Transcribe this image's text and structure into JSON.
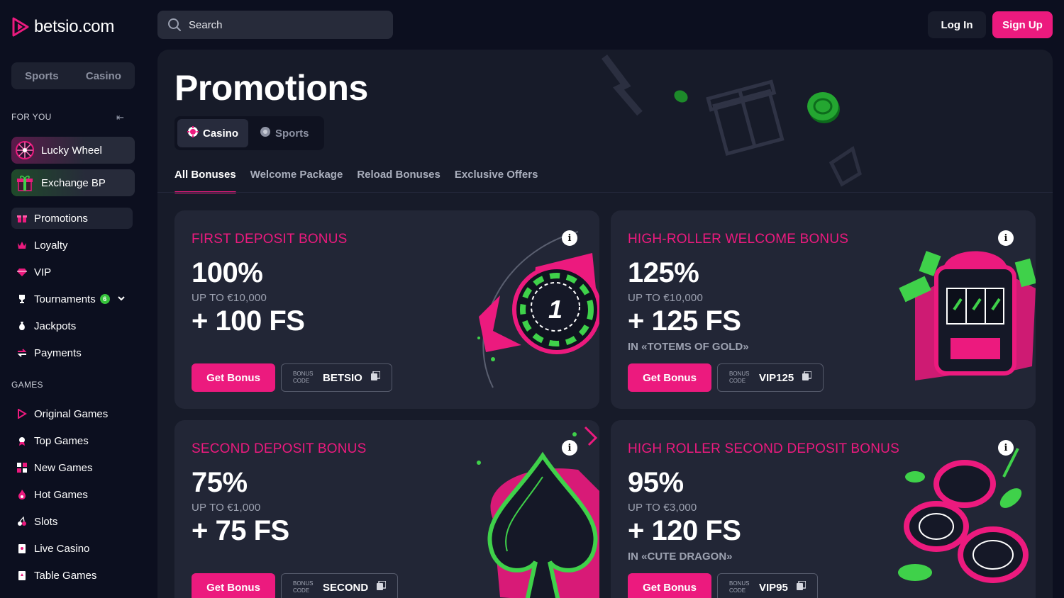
{
  "brand": {
    "name": "betsio.com",
    "accent": "#ec1a7e"
  },
  "header": {
    "search_placeholder": "Search",
    "login_label": "Log In",
    "signup_label": "Sign Up"
  },
  "sidebar": {
    "switcher": [
      "Sports",
      "Casino"
    ],
    "for_you_heading": "FOR YOU",
    "featured": [
      {
        "label": "Lucky Wheel",
        "icon": "wheel-icon"
      },
      {
        "label": "Exchange BP",
        "icon": "gift-icon"
      }
    ],
    "nav": [
      {
        "label": "Promotions",
        "icon": "gift-icon",
        "active": true
      },
      {
        "label": "Loyalty",
        "icon": "crown-icon"
      },
      {
        "label": "VIP",
        "icon": "diamond-icon"
      },
      {
        "label": "Tournaments",
        "icon": "trophy-icon",
        "badge": "6"
      },
      {
        "label": "Jackpots",
        "icon": "moneybag-icon"
      },
      {
        "label": "Payments",
        "icon": "transfer-icon"
      }
    ],
    "games_heading": "GAMES",
    "games": [
      {
        "label": "Original Games",
        "icon": "logo-icon"
      },
      {
        "label": "Top Games",
        "icon": "ribbon-icon"
      },
      {
        "label": "New Games",
        "icon": "grid-icon"
      },
      {
        "label": "Hot Games",
        "icon": "flame-icon"
      },
      {
        "label": "Slots",
        "icon": "cherries-icon"
      },
      {
        "label": "Live Casino",
        "icon": "cards-icon"
      },
      {
        "label": "Table Games",
        "icon": "card-icon"
      }
    ]
  },
  "main": {
    "title": "Promotions",
    "category_tabs": [
      {
        "label": "Casino",
        "active": true
      },
      {
        "label": "Sports",
        "active": false
      }
    ],
    "sub_tabs": [
      {
        "label": "All Bonuses",
        "active": true
      },
      {
        "label": "Welcome Package"
      },
      {
        "label": "Reload Bonuses"
      },
      {
        "label": "Exclusive Offers"
      }
    ],
    "cards": [
      {
        "title": "FIRST DEPOSIT BONUS",
        "percent": "100%",
        "upto": "UP TO €10,000",
        "fs": "+ 100 FS",
        "game": "",
        "button": "Get Bonus",
        "code_label": "BONUS CODE",
        "code": "BETSIO",
        "art": "casino-chip"
      },
      {
        "title": "HIGH-ROLLER WELCOME BONUS",
        "percent": "125%",
        "upto": "UP TO €10,000",
        "fs": "+ 125 FS",
        "game": "IN «TOTEMS OF GOLD»",
        "button": "Get Bonus",
        "code_label": "BONUS CODE",
        "code": "VIP125",
        "art": "slot-machine"
      },
      {
        "title": "SECOND DEPOSIT BONUS",
        "percent": "75%",
        "upto": "UP TO €1,000",
        "fs": "+ 75 FS",
        "game": "",
        "button": "Get Bonus",
        "code_label": "BONUS CODE",
        "code": "SECOND",
        "art": "spade"
      },
      {
        "title": "HIGH ROLLER SECOND DEPOSIT BONUS",
        "percent": "95%",
        "upto": "UP TO €3,000",
        "fs": "+ 120 FS",
        "game": "IN «CUTE DRAGON»",
        "button": "Get Bonus",
        "code_label": "BONUS CODE",
        "code": "VIP95",
        "art": "chip-stack"
      }
    ]
  }
}
